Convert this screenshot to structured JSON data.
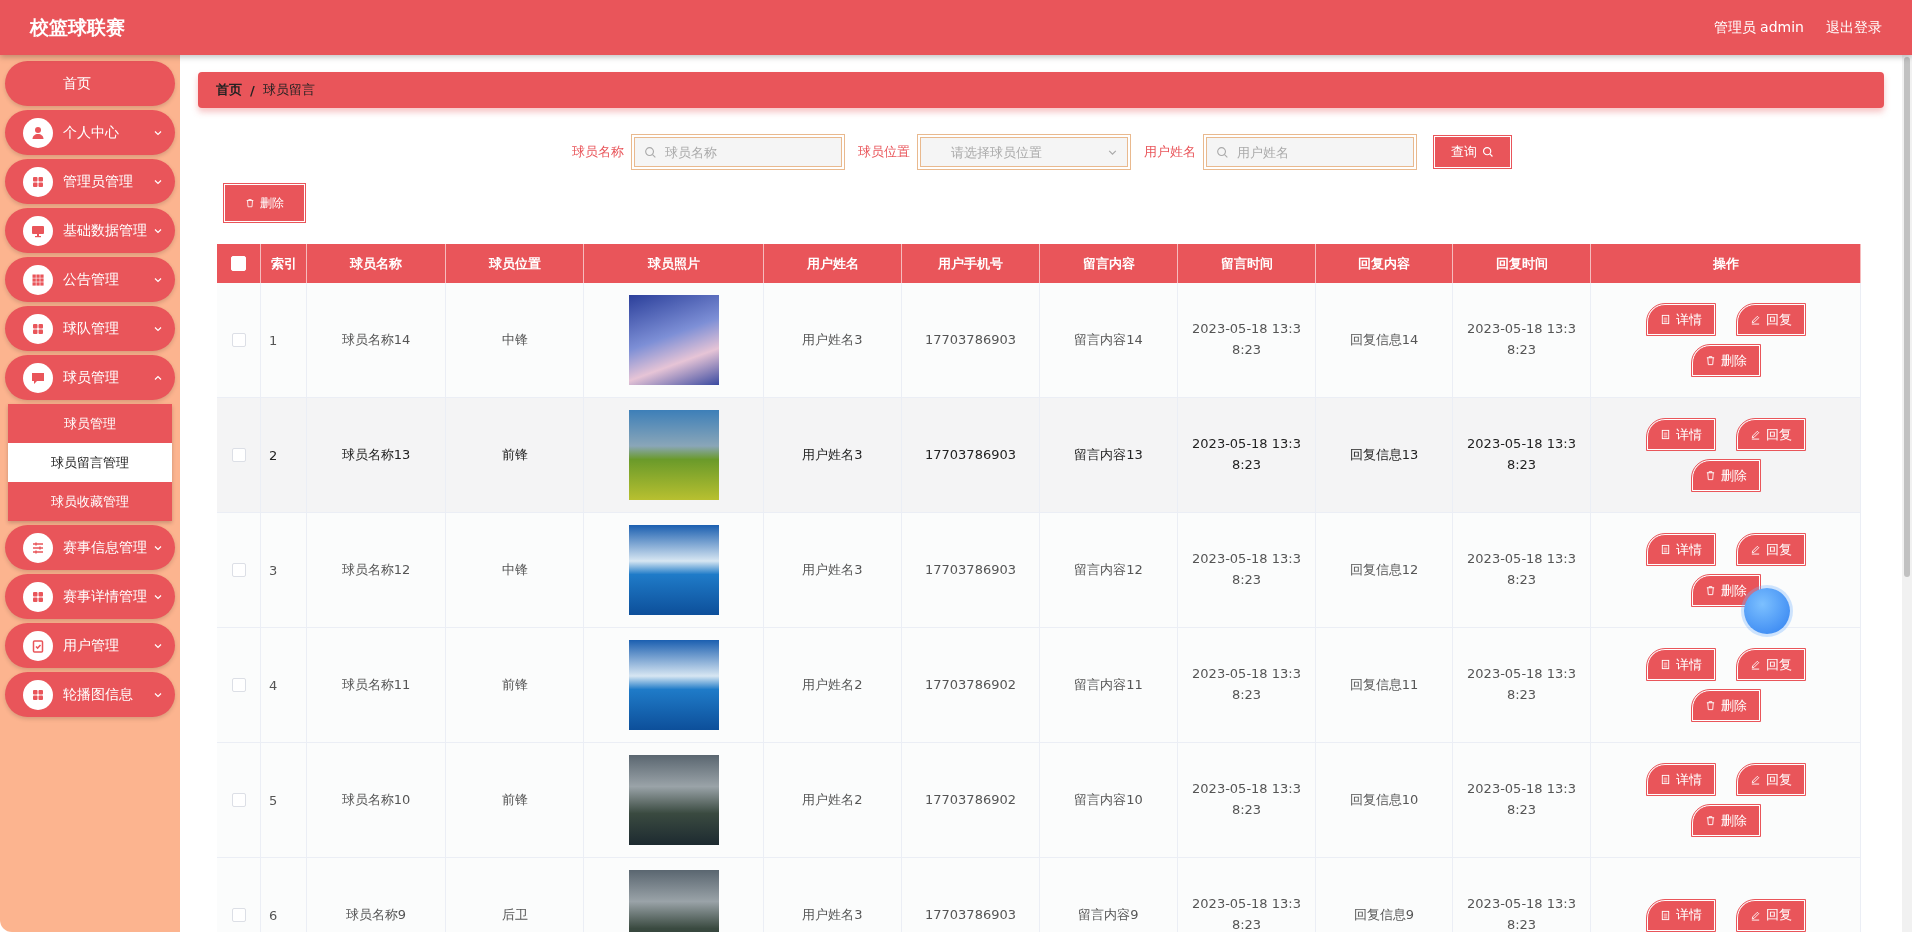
{
  "header": {
    "title": "校篮球联赛",
    "user": "管理员 admin",
    "logout": "退出登录"
  },
  "sidebar": {
    "items": [
      {
        "label": "首页"
      },
      {
        "label": "个人中心",
        "expanded": false
      },
      {
        "label": "管理员管理",
        "expanded": false
      },
      {
        "label": "基础数据管理",
        "expanded": false
      },
      {
        "label": "公告管理",
        "expanded": false
      },
      {
        "label": "球队管理",
        "expanded": false
      },
      {
        "label": "球员管理",
        "expanded": true,
        "children": [
          {
            "label": "球员管理",
            "selected": false
          },
          {
            "label": "球员留言管理",
            "selected": true
          },
          {
            "label": "球员收藏管理",
            "selected": false
          }
        ]
      },
      {
        "label": "赛事信息管理",
        "expanded": false
      },
      {
        "label": "赛事详情管理",
        "expanded": false
      },
      {
        "label": "用户管理",
        "expanded": false
      },
      {
        "label": "轮播图信息",
        "expanded": false
      }
    ]
  },
  "breadcrumb": {
    "items": [
      "首页",
      "球员留言"
    ],
    "separator": "/"
  },
  "search": {
    "fields": [
      {
        "label": "球员名称",
        "kind": "text",
        "placeholder": "球员名称"
      },
      {
        "label": "球员位置",
        "kind": "select",
        "placeholder": "请选择球员位置"
      },
      {
        "label": "用户姓名",
        "kind": "text",
        "placeholder": "用户姓名"
      }
    ],
    "button": "查询"
  },
  "toolbar": {
    "delete": "删除"
  },
  "table": {
    "all_checked": false,
    "columns": [
      "索引",
      "球员名称",
      "球员位置",
      "球员照片",
      "用户姓名",
      "用户手机号",
      "留言内容",
      "留言时间",
      "回复内容",
      "回复时间",
      "操作"
    ],
    "rows": [
      {
        "checked": false,
        "hovered": false,
        "cells": [
          "1",
          "球员名称14",
          "中锋",
          "",
          "用户姓名3",
          "17703786903",
          "留言内容14",
          "2023-05-18 13:38:23",
          "回复信息14",
          "2023-05-18 13:38:23"
        ],
        "actions": [
          {
            "kind": "detail",
            "label": "详情"
          },
          {
            "kind": "reply",
            "label": "回复"
          },
          {
            "kind": "delete",
            "label": "删除"
          }
        ]
      },
      {
        "checked": false,
        "hovered": true,
        "cells": [
          "2",
          "球员名称13",
          "前锋",
          "",
          "用户姓名3",
          "17703786903",
          "留言内容13",
          "2023-05-18 13:38:23",
          "回复信息13",
          "2023-05-18 13:38:23"
        ],
        "actions": [
          {
            "kind": "detail",
            "label": "详情"
          },
          {
            "kind": "reply",
            "label": "回复"
          },
          {
            "kind": "delete",
            "label": "删除"
          }
        ]
      },
      {
        "checked": false,
        "hovered": false,
        "cells": [
          "3",
          "球员名称12",
          "中锋",
          "",
          "用户姓名3",
          "17703786903",
          "留言内容12",
          "2023-05-18 13:38:23",
          "回复信息12",
          "2023-05-18 13:38:23"
        ],
        "actions": [
          {
            "kind": "detail",
            "label": "详情"
          },
          {
            "kind": "reply",
            "label": "回复"
          },
          {
            "kind": "delete",
            "label": "删除"
          }
        ]
      },
      {
        "checked": false,
        "hovered": false,
        "cells": [
          "4",
          "球员名称11",
          "前锋",
          "",
          "用户姓名2",
          "17703786902",
          "留言内容11",
          "2023-05-18 13:38:23",
          "回复信息11",
          "2023-05-18 13:38:23"
        ],
        "actions": [
          {
            "kind": "detail",
            "label": "详情"
          },
          {
            "kind": "reply",
            "label": "回复"
          },
          {
            "kind": "delete",
            "label": "删除"
          }
        ]
      },
      {
        "checked": false,
        "hovered": false,
        "cells": [
          "5",
          "球员名称10",
          "前锋",
          "",
          "用户姓名2",
          "17703786902",
          "留言内容10",
          "2023-05-18 13:38:23",
          "回复信息10",
          "2023-05-18 13:38:23"
        ],
        "actions": [
          {
            "kind": "detail",
            "label": "详情"
          },
          {
            "kind": "reply",
            "label": "回复"
          },
          {
            "kind": "delete",
            "label": "删除"
          }
        ]
      },
      {
        "checked": false,
        "hovered": false,
        "cells": [
          "6",
          "球员名称9",
          "后卫",
          "",
          "用户姓名3",
          "17703786903",
          "留言内容9",
          "2023-05-18 13:38:23",
          "回复信息9",
          "2023-05-18 13:38:23"
        ],
        "actions": [
          {
            "kind": "detail",
            "label": "详情"
          },
          {
            "kind": "reply",
            "label": "回复"
          }
        ]
      }
    ]
  }
}
